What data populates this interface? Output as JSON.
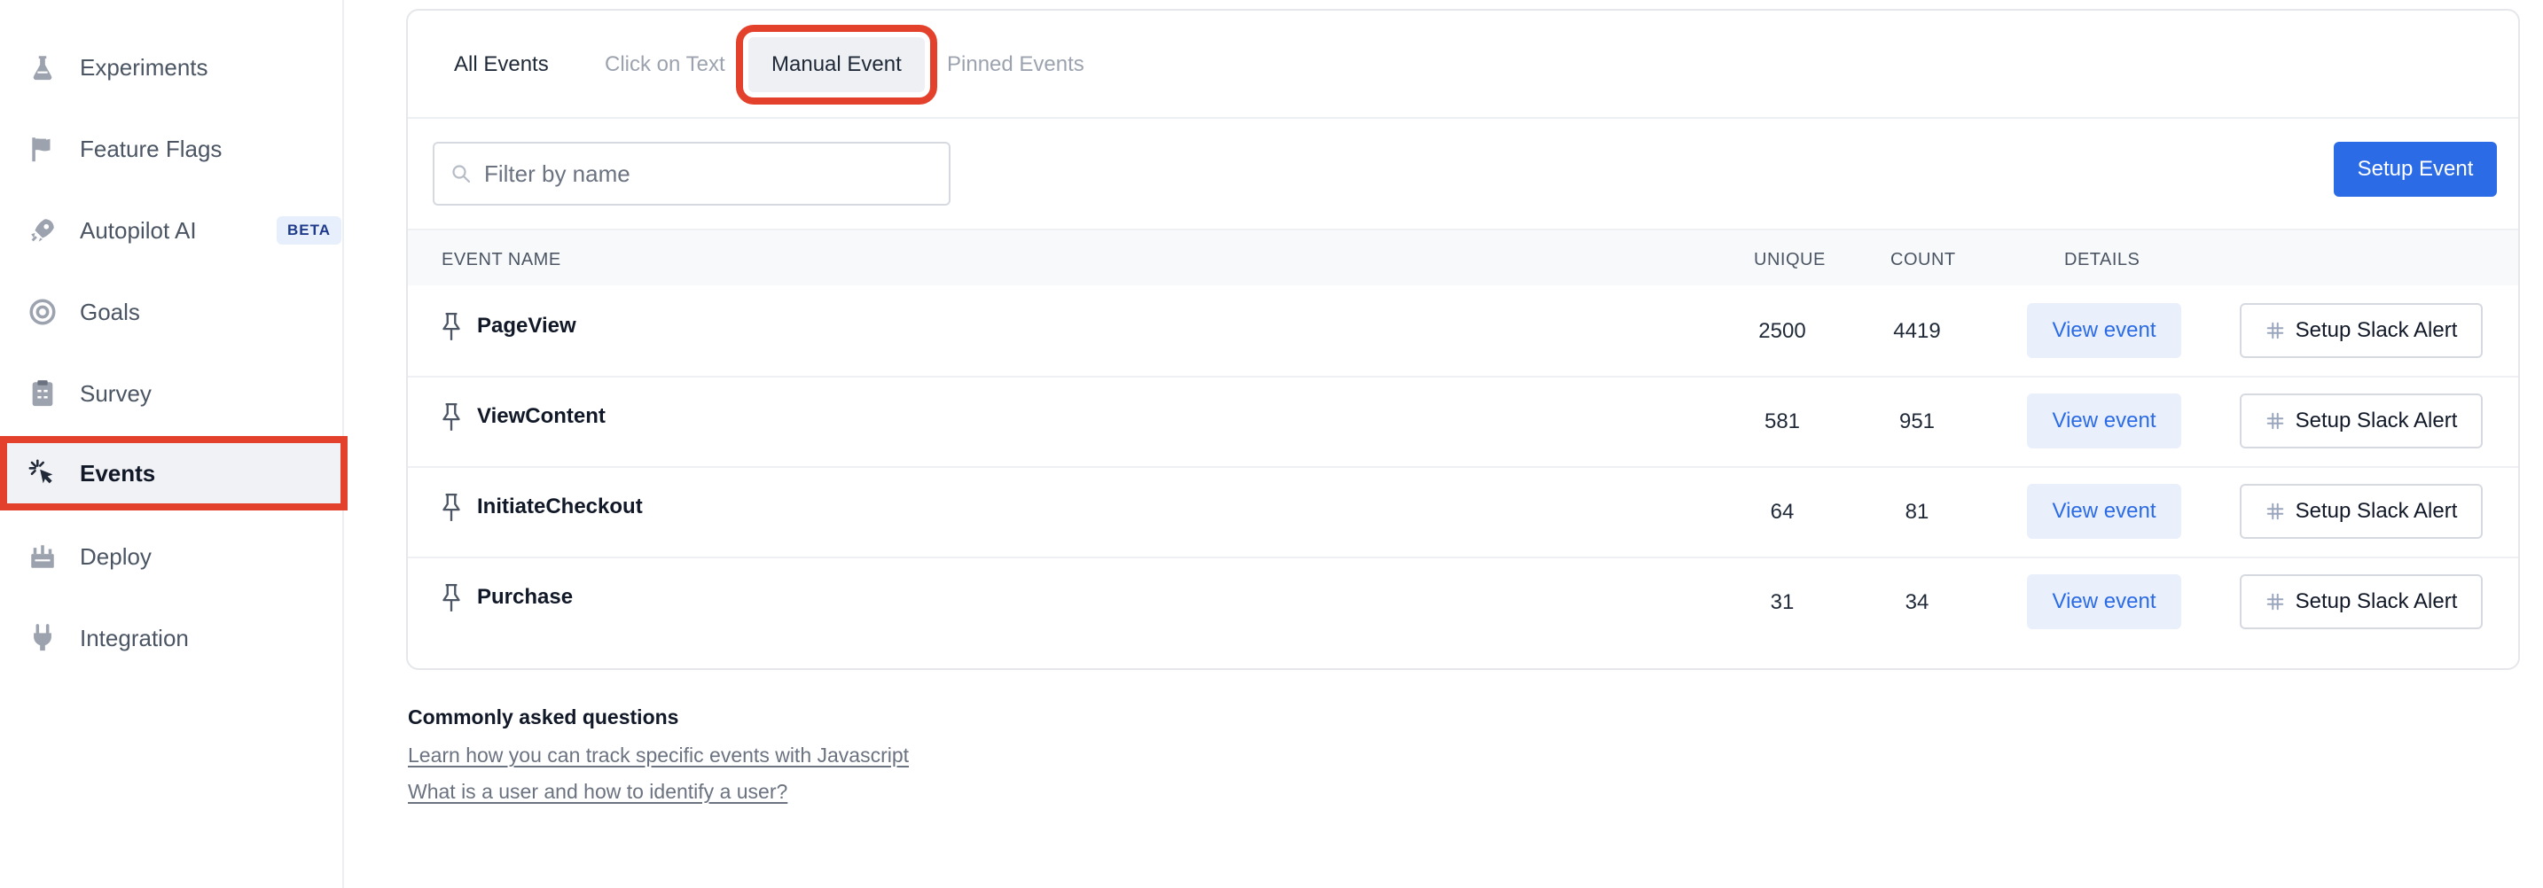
{
  "sidebar": {
    "items": [
      {
        "label": "Experiments",
        "icon": "flask-icon"
      },
      {
        "label": "Feature Flags",
        "icon": "flag-icon"
      },
      {
        "label": "Autopilot AI",
        "icon": "rocket-icon",
        "badge": "BETA"
      },
      {
        "label": "Goals",
        "icon": "target-icon"
      },
      {
        "label": "Survey",
        "icon": "clipboard-icon"
      },
      {
        "label": "Events",
        "icon": "cursor-click-icon",
        "active": true
      },
      {
        "label": "Deploy",
        "icon": "deploy-icon"
      },
      {
        "label": "Integration",
        "icon": "plug-icon"
      }
    ]
  },
  "tabs": [
    {
      "label": "All Events"
    },
    {
      "label": "Click on Text"
    },
    {
      "label": "Manual Event",
      "selected": true
    },
    {
      "label": "Pinned Events"
    }
  ],
  "filter": {
    "placeholder": "Filter by name",
    "value": ""
  },
  "setup_event_label": "Setup Event",
  "table": {
    "headers": {
      "event_name": "EVENT NAME",
      "unique": "UNIQUE",
      "count": "COUNT",
      "details": "DETAILS"
    },
    "rows": [
      {
        "name": "PageView",
        "unique": "2500",
        "count": "4419",
        "view": "View event",
        "alert": "Setup Slack Alert"
      },
      {
        "name": "ViewContent",
        "unique": "581",
        "count": "951",
        "view": "View event",
        "alert": "Setup Slack Alert"
      },
      {
        "name": "InitiateCheckout",
        "unique": "64",
        "count": "81",
        "view": "View event",
        "alert": "Setup Slack Alert"
      },
      {
        "name": "Purchase",
        "unique": "31",
        "count": "34",
        "view": "View event",
        "alert": "Setup Slack Alert"
      }
    ]
  },
  "faq": {
    "title": "Commonly asked questions",
    "links": [
      "Learn how you can track specific events with Javascript",
      "What is a user and how to identify a user?"
    ]
  },
  "colors": {
    "accent": "#2b6be5",
    "highlight_border": "#e3412b",
    "sidebar_active_bg": "#f1f2f5"
  }
}
